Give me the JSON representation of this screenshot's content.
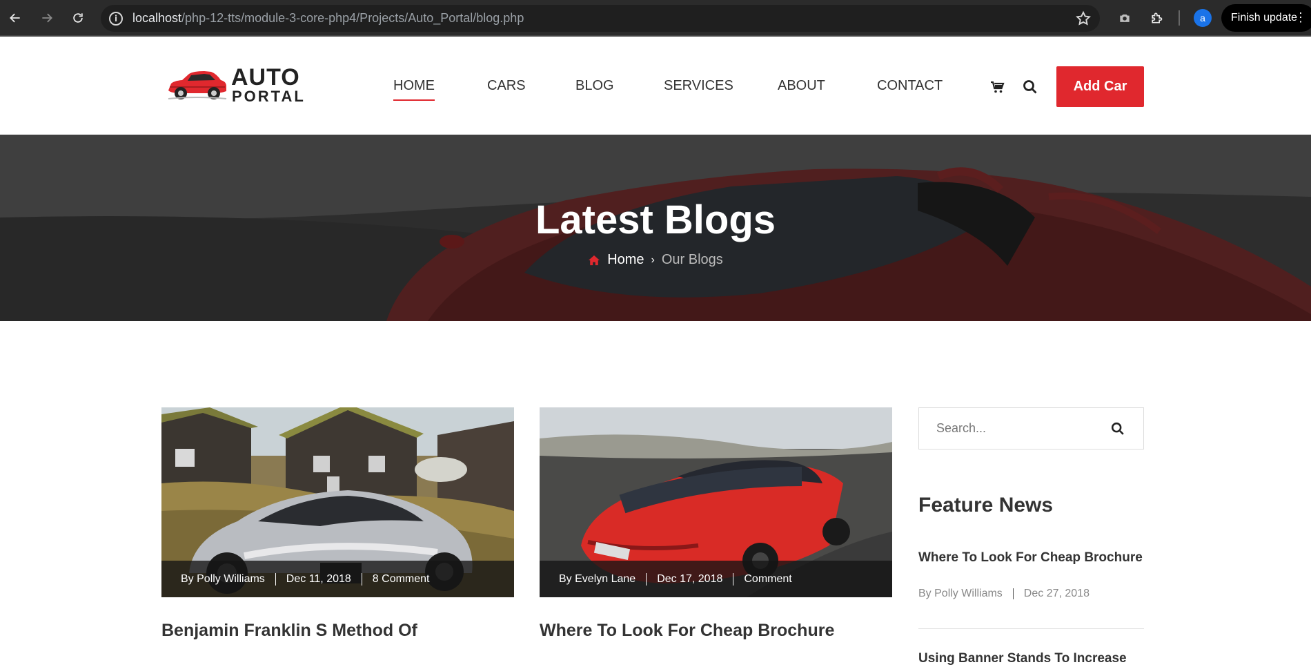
{
  "browser": {
    "url_host": "localhost",
    "url_path": "/php-12-tts/module-3-core-php4/Projects/Auto_Portal/blog.php",
    "profile_initial": "a",
    "finish_update_label": "Finish update"
  },
  "header": {
    "logo_line1": "AUTO",
    "logo_line2": "PORTAL",
    "nav": [
      {
        "label": "HOME",
        "active": true
      },
      {
        "label": "CARS"
      },
      {
        "label": "BLOG"
      },
      {
        "label": "SERVICES"
      },
      {
        "label": "ABOUT"
      },
      {
        "label": "CONTACT"
      }
    ],
    "add_car_label": "Add Car",
    "accent_color": "#e0282e"
  },
  "hero": {
    "title": "Latest Blogs",
    "breadcrumb_home": "Home",
    "breadcrumb_current": "Our Blogs"
  },
  "posts": [
    {
      "author": "By Polly Williams",
      "date": "Dec 11, 2018",
      "comments": "8 Comment",
      "title": "Benjamin Franklin S Method Of",
      "image": "silver-sports-car-photo"
    },
    {
      "author": "By Evelyn Lane",
      "date": "Dec 17, 2018",
      "comments": "Comment",
      "title": "Where To Look For Cheap Brochure",
      "image": "red-sports-car-photo"
    }
  ],
  "sidebar": {
    "search_placeholder": "Search...",
    "feature_heading": "Feature News",
    "news": [
      {
        "title": "Where To Look For Cheap Brochure",
        "author": "By Polly Williams",
        "date": "Dec 27, 2018"
      },
      {
        "title": "Using Banner Stands To Increase"
      }
    ]
  }
}
